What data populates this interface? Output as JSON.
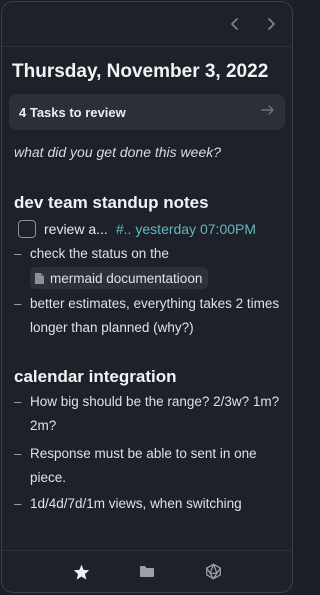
{
  "header": {
    "date": "Thursday, November 3, 2022"
  },
  "review_banner": {
    "label": "4 Tasks to review"
  },
  "prompt": "what did you get done this week?",
  "sections": [
    {
      "title": "dev team standup notes",
      "task": {
        "text": "review a...",
        "tag": "#..",
        "time": "yesterday 07:00PM",
        "checked": false
      },
      "bullets": [
        "check the status on the",
        "better estimates, everything takes 2 times longer than planned (why?)"
      ],
      "doc_link": "mermaid documentatioon"
    },
    {
      "title": "calendar integration",
      "bullets": [
        "How big should be the range? 2/3w? 1m? 2m?",
        "Response must be able to sent in one piece.",
        "1d/4d/7d/1m views, when switching"
      ]
    }
  ],
  "icons": {
    "nav_prev": "chevron-left-icon",
    "nav_next": "chevron-right-icon",
    "review_arrow": "arrow-right-icon",
    "doc": "document-icon",
    "bottom": [
      "star-icon",
      "folder-icon",
      "dice-icon"
    ]
  },
  "colors": {
    "background": "#1e2129",
    "accent_teal": "#63b7bf",
    "banner": "#2b2f38"
  }
}
